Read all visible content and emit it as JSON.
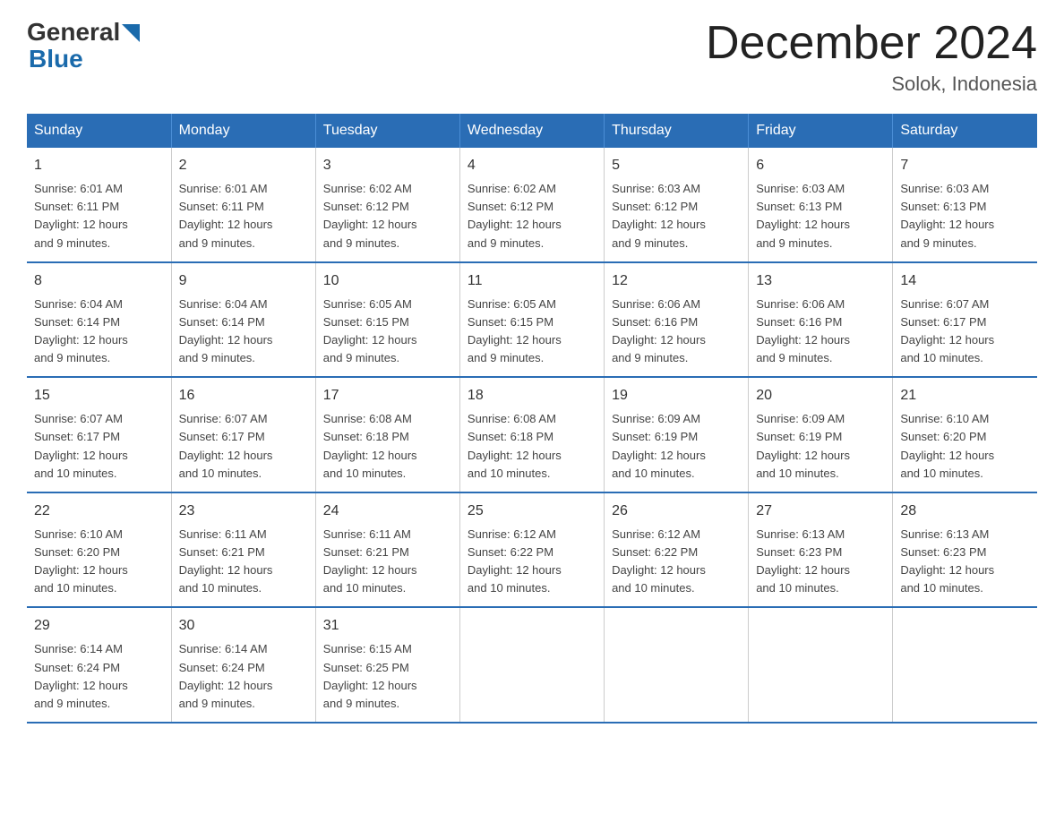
{
  "logo": {
    "general": "General",
    "blue": "Blue"
  },
  "title": "December 2024",
  "subtitle": "Solok, Indonesia",
  "weekdays": [
    "Sunday",
    "Monday",
    "Tuesday",
    "Wednesday",
    "Thursday",
    "Friday",
    "Saturday"
  ],
  "weeks": [
    [
      {
        "day": "1",
        "sunrise": "Sunrise: 6:01 AM",
        "sunset": "Sunset: 6:11 PM",
        "daylight": "Daylight: 12 hours",
        "minutes": "and 9 minutes."
      },
      {
        "day": "2",
        "sunrise": "Sunrise: 6:01 AM",
        "sunset": "Sunset: 6:11 PM",
        "daylight": "Daylight: 12 hours",
        "minutes": "and 9 minutes."
      },
      {
        "day": "3",
        "sunrise": "Sunrise: 6:02 AM",
        "sunset": "Sunset: 6:12 PM",
        "daylight": "Daylight: 12 hours",
        "minutes": "and 9 minutes."
      },
      {
        "day": "4",
        "sunrise": "Sunrise: 6:02 AM",
        "sunset": "Sunset: 6:12 PM",
        "daylight": "Daylight: 12 hours",
        "minutes": "and 9 minutes."
      },
      {
        "day": "5",
        "sunrise": "Sunrise: 6:03 AM",
        "sunset": "Sunset: 6:12 PM",
        "daylight": "Daylight: 12 hours",
        "minutes": "and 9 minutes."
      },
      {
        "day": "6",
        "sunrise": "Sunrise: 6:03 AM",
        "sunset": "Sunset: 6:13 PM",
        "daylight": "Daylight: 12 hours",
        "minutes": "and 9 minutes."
      },
      {
        "day": "7",
        "sunrise": "Sunrise: 6:03 AM",
        "sunset": "Sunset: 6:13 PM",
        "daylight": "Daylight: 12 hours",
        "minutes": "and 9 minutes."
      }
    ],
    [
      {
        "day": "8",
        "sunrise": "Sunrise: 6:04 AM",
        "sunset": "Sunset: 6:14 PM",
        "daylight": "Daylight: 12 hours",
        "minutes": "and 9 minutes."
      },
      {
        "day": "9",
        "sunrise": "Sunrise: 6:04 AM",
        "sunset": "Sunset: 6:14 PM",
        "daylight": "Daylight: 12 hours",
        "minutes": "and 9 minutes."
      },
      {
        "day": "10",
        "sunrise": "Sunrise: 6:05 AM",
        "sunset": "Sunset: 6:15 PM",
        "daylight": "Daylight: 12 hours",
        "minutes": "and 9 minutes."
      },
      {
        "day": "11",
        "sunrise": "Sunrise: 6:05 AM",
        "sunset": "Sunset: 6:15 PM",
        "daylight": "Daylight: 12 hours",
        "minutes": "and 9 minutes."
      },
      {
        "day": "12",
        "sunrise": "Sunrise: 6:06 AM",
        "sunset": "Sunset: 6:16 PM",
        "daylight": "Daylight: 12 hours",
        "minutes": "and 9 minutes."
      },
      {
        "day": "13",
        "sunrise": "Sunrise: 6:06 AM",
        "sunset": "Sunset: 6:16 PM",
        "daylight": "Daylight: 12 hours",
        "minutes": "and 9 minutes."
      },
      {
        "day": "14",
        "sunrise": "Sunrise: 6:07 AM",
        "sunset": "Sunset: 6:17 PM",
        "daylight": "Daylight: 12 hours",
        "minutes": "and 10 minutes."
      }
    ],
    [
      {
        "day": "15",
        "sunrise": "Sunrise: 6:07 AM",
        "sunset": "Sunset: 6:17 PM",
        "daylight": "Daylight: 12 hours",
        "minutes": "and 10 minutes."
      },
      {
        "day": "16",
        "sunrise": "Sunrise: 6:07 AM",
        "sunset": "Sunset: 6:17 PM",
        "daylight": "Daylight: 12 hours",
        "minutes": "and 10 minutes."
      },
      {
        "day": "17",
        "sunrise": "Sunrise: 6:08 AM",
        "sunset": "Sunset: 6:18 PM",
        "daylight": "Daylight: 12 hours",
        "minutes": "and 10 minutes."
      },
      {
        "day": "18",
        "sunrise": "Sunrise: 6:08 AM",
        "sunset": "Sunset: 6:18 PM",
        "daylight": "Daylight: 12 hours",
        "minutes": "and 10 minutes."
      },
      {
        "day": "19",
        "sunrise": "Sunrise: 6:09 AM",
        "sunset": "Sunset: 6:19 PM",
        "daylight": "Daylight: 12 hours",
        "minutes": "and 10 minutes."
      },
      {
        "day": "20",
        "sunrise": "Sunrise: 6:09 AM",
        "sunset": "Sunset: 6:19 PM",
        "daylight": "Daylight: 12 hours",
        "minutes": "and 10 minutes."
      },
      {
        "day": "21",
        "sunrise": "Sunrise: 6:10 AM",
        "sunset": "Sunset: 6:20 PM",
        "daylight": "Daylight: 12 hours",
        "minutes": "and 10 minutes."
      }
    ],
    [
      {
        "day": "22",
        "sunrise": "Sunrise: 6:10 AM",
        "sunset": "Sunset: 6:20 PM",
        "daylight": "Daylight: 12 hours",
        "minutes": "and 10 minutes."
      },
      {
        "day": "23",
        "sunrise": "Sunrise: 6:11 AM",
        "sunset": "Sunset: 6:21 PM",
        "daylight": "Daylight: 12 hours",
        "minutes": "and 10 minutes."
      },
      {
        "day": "24",
        "sunrise": "Sunrise: 6:11 AM",
        "sunset": "Sunset: 6:21 PM",
        "daylight": "Daylight: 12 hours",
        "minutes": "and 10 minutes."
      },
      {
        "day": "25",
        "sunrise": "Sunrise: 6:12 AM",
        "sunset": "Sunset: 6:22 PM",
        "daylight": "Daylight: 12 hours",
        "minutes": "and 10 minutes."
      },
      {
        "day": "26",
        "sunrise": "Sunrise: 6:12 AM",
        "sunset": "Sunset: 6:22 PM",
        "daylight": "Daylight: 12 hours",
        "minutes": "and 10 minutes."
      },
      {
        "day": "27",
        "sunrise": "Sunrise: 6:13 AM",
        "sunset": "Sunset: 6:23 PM",
        "daylight": "Daylight: 12 hours",
        "minutes": "and 10 minutes."
      },
      {
        "day": "28",
        "sunrise": "Sunrise: 6:13 AM",
        "sunset": "Sunset: 6:23 PM",
        "daylight": "Daylight: 12 hours",
        "minutes": "and 10 minutes."
      }
    ],
    [
      {
        "day": "29",
        "sunrise": "Sunrise: 6:14 AM",
        "sunset": "Sunset: 6:24 PM",
        "daylight": "Daylight: 12 hours",
        "minutes": "and 9 minutes."
      },
      {
        "day": "30",
        "sunrise": "Sunrise: 6:14 AM",
        "sunset": "Sunset: 6:24 PM",
        "daylight": "Daylight: 12 hours",
        "minutes": "and 9 minutes."
      },
      {
        "day": "31",
        "sunrise": "Sunrise: 6:15 AM",
        "sunset": "Sunset: 6:25 PM",
        "daylight": "Daylight: 12 hours",
        "minutes": "and 9 minutes."
      },
      null,
      null,
      null,
      null
    ]
  ]
}
